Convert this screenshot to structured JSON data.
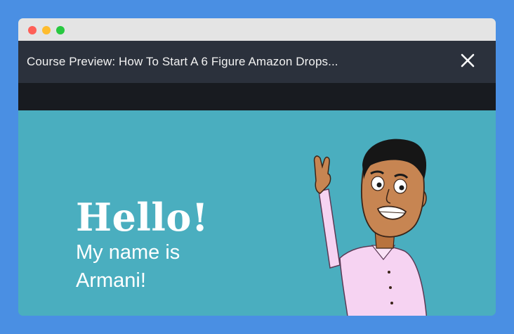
{
  "window": {
    "controls": [
      "close",
      "minimize",
      "zoom"
    ]
  },
  "header": {
    "title": "Course Preview: How To Start A 6 Figure Amazon Drops...",
    "close_icon": "close-icon"
  },
  "video": {
    "greeting": "Hello!",
    "line1": "My name is",
    "line2": "Armani!",
    "background_color": "#4aaebf",
    "character_icon": "waving-man-illustration"
  }
}
